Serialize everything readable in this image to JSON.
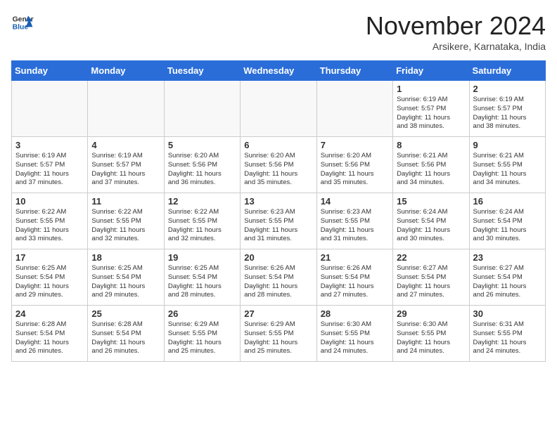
{
  "header": {
    "logo_line1": "General",
    "logo_line2": "Blue",
    "month_title": "November 2024",
    "subtitle": "Arsikere, Karnataka, India"
  },
  "weekdays": [
    "Sunday",
    "Monday",
    "Tuesday",
    "Wednesday",
    "Thursday",
    "Friday",
    "Saturday"
  ],
  "weeks": [
    [
      {
        "day": "",
        "info": ""
      },
      {
        "day": "",
        "info": ""
      },
      {
        "day": "",
        "info": ""
      },
      {
        "day": "",
        "info": ""
      },
      {
        "day": "",
        "info": ""
      },
      {
        "day": "1",
        "info": "Sunrise: 6:19 AM\nSunset: 5:57 PM\nDaylight: 11 hours\nand 38 minutes."
      },
      {
        "day": "2",
        "info": "Sunrise: 6:19 AM\nSunset: 5:57 PM\nDaylight: 11 hours\nand 38 minutes."
      }
    ],
    [
      {
        "day": "3",
        "info": "Sunrise: 6:19 AM\nSunset: 5:57 PM\nDaylight: 11 hours\nand 37 minutes."
      },
      {
        "day": "4",
        "info": "Sunrise: 6:19 AM\nSunset: 5:57 PM\nDaylight: 11 hours\nand 37 minutes."
      },
      {
        "day": "5",
        "info": "Sunrise: 6:20 AM\nSunset: 5:56 PM\nDaylight: 11 hours\nand 36 minutes."
      },
      {
        "day": "6",
        "info": "Sunrise: 6:20 AM\nSunset: 5:56 PM\nDaylight: 11 hours\nand 35 minutes."
      },
      {
        "day": "7",
        "info": "Sunrise: 6:20 AM\nSunset: 5:56 PM\nDaylight: 11 hours\nand 35 minutes."
      },
      {
        "day": "8",
        "info": "Sunrise: 6:21 AM\nSunset: 5:56 PM\nDaylight: 11 hours\nand 34 minutes."
      },
      {
        "day": "9",
        "info": "Sunrise: 6:21 AM\nSunset: 5:55 PM\nDaylight: 11 hours\nand 34 minutes."
      }
    ],
    [
      {
        "day": "10",
        "info": "Sunrise: 6:22 AM\nSunset: 5:55 PM\nDaylight: 11 hours\nand 33 minutes."
      },
      {
        "day": "11",
        "info": "Sunrise: 6:22 AM\nSunset: 5:55 PM\nDaylight: 11 hours\nand 32 minutes."
      },
      {
        "day": "12",
        "info": "Sunrise: 6:22 AM\nSunset: 5:55 PM\nDaylight: 11 hours\nand 32 minutes."
      },
      {
        "day": "13",
        "info": "Sunrise: 6:23 AM\nSunset: 5:55 PM\nDaylight: 11 hours\nand 31 minutes."
      },
      {
        "day": "14",
        "info": "Sunrise: 6:23 AM\nSunset: 5:55 PM\nDaylight: 11 hours\nand 31 minutes."
      },
      {
        "day": "15",
        "info": "Sunrise: 6:24 AM\nSunset: 5:54 PM\nDaylight: 11 hours\nand 30 minutes."
      },
      {
        "day": "16",
        "info": "Sunrise: 6:24 AM\nSunset: 5:54 PM\nDaylight: 11 hours\nand 30 minutes."
      }
    ],
    [
      {
        "day": "17",
        "info": "Sunrise: 6:25 AM\nSunset: 5:54 PM\nDaylight: 11 hours\nand 29 minutes."
      },
      {
        "day": "18",
        "info": "Sunrise: 6:25 AM\nSunset: 5:54 PM\nDaylight: 11 hours\nand 29 minutes."
      },
      {
        "day": "19",
        "info": "Sunrise: 6:25 AM\nSunset: 5:54 PM\nDaylight: 11 hours\nand 28 minutes."
      },
      {
        "day": "20",
        "info": "Sunrise: 6:26 AM\nSunset: 5:54 PM\nDaylight: 11 hours\nand 28 minutes."
      },
      {
        "day": "21",
        "info": "Sunrise: 6:26 AM\nSunset: 5:54 PM\nDaylight: 11 hours\nand 27 minutes."
      },
      {
        "day": "22",
        "info": "Sunrise: 6:27 AM\nSunset: 5:54 PM\nDaylight: 11 hours\nand 27 minutes."
      },
      {
        "day": "23",
        "info": "Sunrise: 6:27 AM\nSunset: 5:54 PM\nDaylight: 11 hours\nand 26 minutes."
      }
    ],
    [
      {
        "day": "24",
        "info": "Sunrise: 6:28 AM\nSunset: 5:54 PM\nDaylight: 11 hours\nand 26 minutes."
      },
      {
        "day": "25",
        "info": "Sunrise: 6:28 AM\nSunset: 5:54 PM\nDaylight: 11 hours\nand 26 minutes."
      },
      {
        "day": "26",
        "info": "Sunrise: 6:29 AM\nSunset: 5:55 PM\nDaylight: 11 hours\nand 25 minutes."
      },
      {
        "day": "27",
        "info": "Sunrise: 6:29 AM\nSunset: 5:55 PM\nDaylight: 11 hours\nand 25 minutes."
      },
      {
        "day": "28",
        "info": "Sunrise: 6:30 AM\nSunset: 5:55 PM\nDaylight: 11 hours\nand 24 minutes."
      },
      {
        "day": "29",
        "info": "Sunrise: 6:30 AM\nSunset: 5:55 PM\nDaylight: 11 hours\nand 24 minutes."
      },
      {
        "day": "30",
        "info": "Sunrise: 6:31 AM\nSunset: 5:55 PM\nDaylight: 11 hours\nand 24 minutes."
      }
    ]
  ]
}
